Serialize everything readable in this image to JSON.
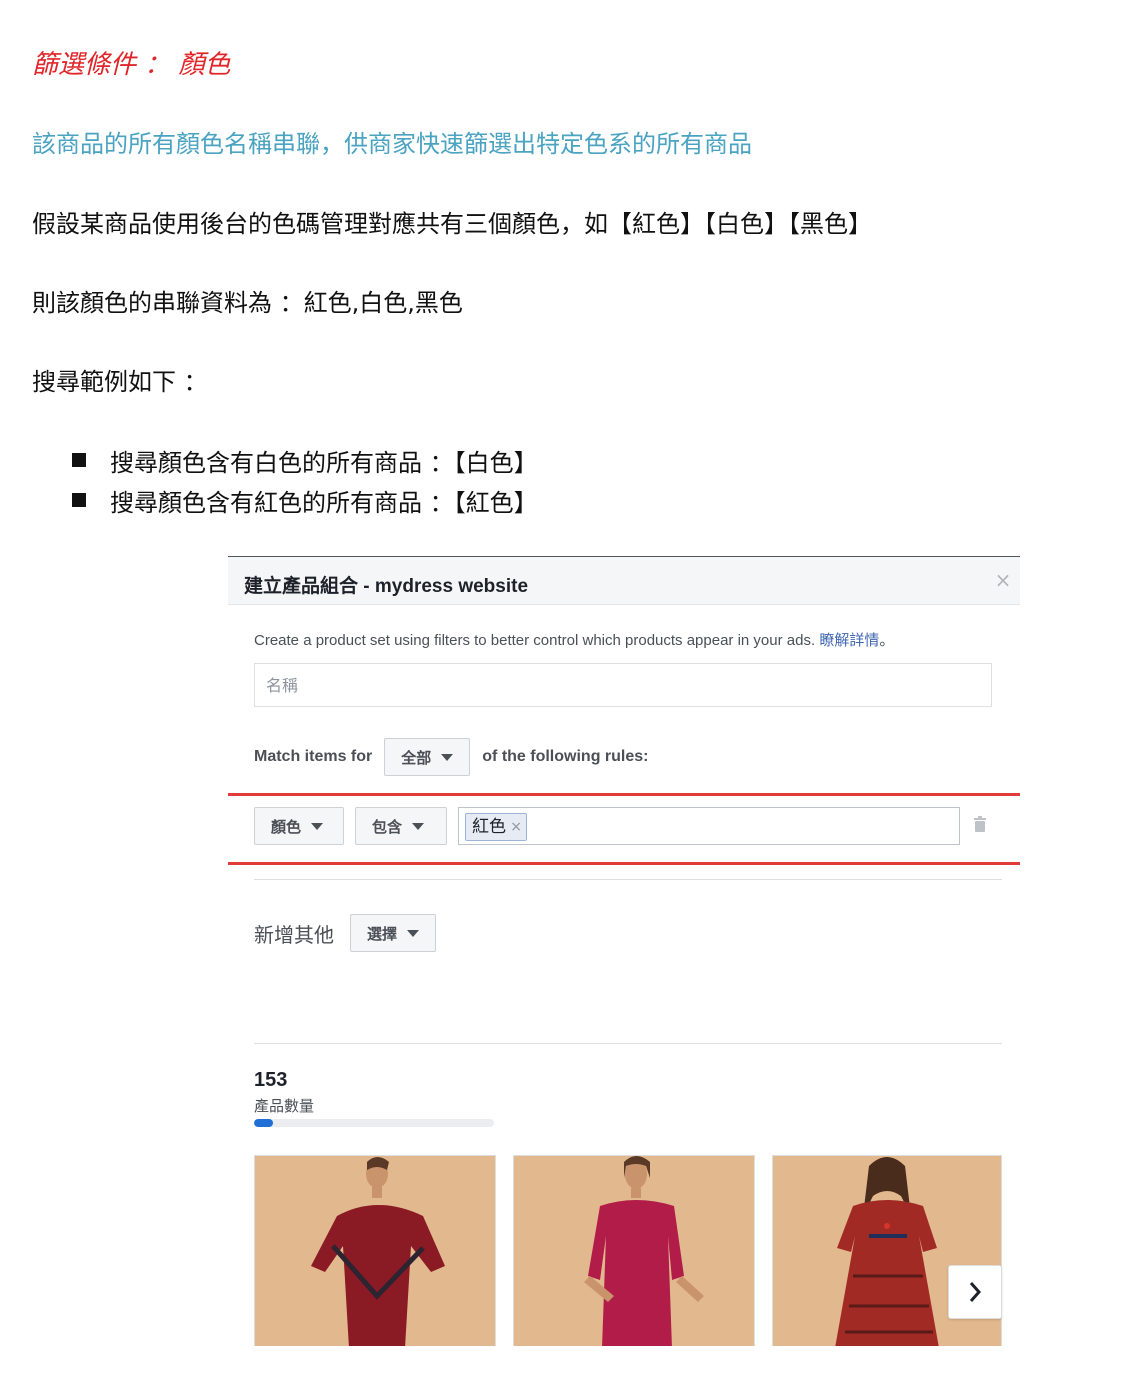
{
  "doc": {
    "heading": "篩選條件 ： 顏色",
    "description": "該商品的所有顏色名稱串聯，供商家快速篩選出特定色系的所有商品",
    "paragraph1": "假設某商品使用後台的色碼管理對應共有三個顏色，如【紅色】【白色】【黑色】",
    "paragraph2": "則該顏色的串聯資料為 ：紅色,白色,黑色",
    "paragraph3": "搜尋範例如下 ：",
    "bullets": [
      "搜尋顏色含有白色的所有商品 ：【白色】",
      "搜尋顏色含有紅色的所有商品 ：【紅色】"
    ]
  },
  "dialog": {
    "title": "建立產品組合 - mydress website",
    "close_glyph": "×",
    "intro": "Create a product set using filters to better control which products appear in your ads.",
    "intro_link": "瞭解詳情",
    "intro_end": "。",
    "name_placeholder": "名稱",
    "match_prefix": "Match items for",
    "match_value": "全部",
    "match_suffix": "of the following rules:",
    "rule": {
      "attribute": "顏色",
      "operator": "包含",
      "token": "紅色",
      "token_remove": "×"
    },
    "add_label": "新增其他",
    "add_select": "選擇",
    "count": "153",
    "count_label": "產品數量",
    "progress_fraction": 0.08,
    "accent_color": "#1f6fd6",
    "highlight_color": "#e23a36"
  }
}
